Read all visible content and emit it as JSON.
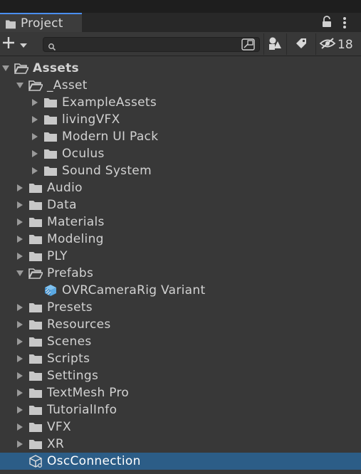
{
  "window": {
    "tab_label": "Project"
  },
  "toolbar": {
    "search_value": "",
    "hidden_count": "18"
  },
  "tree": {
    "assets": "Assets",
    "asset": "_Asset",
    "example_assets": "ExampleAssets",
    "living_vfx": "livingVFX",
    "modern_ui_pack": "Modern UI Pack",
    "oculus": "Oculus",
    "sound_system": "Sound System",
    "audio": "Audio",
    "data": "Data",
    "materials": "Materials",
    "modeling": "Modeling",
    "ply": "PLY",
    "prefabs": "Prefabs",
    "ovr_camera_rig": "OVRCameraRig Variant",
    "presets": "Presets",
    "resources": "Resources",
    "scenes": "Scenes",
    "scripts": "Scripts",
    "settings": "Settings",
    "textmesh_pro": "TextMesh Pro",
    "tutorial_info": "TutorialInfo",
    "vfx": "VFX",
    "xr": "XR",
    "osc_connection": "OscConnection"
  },
  "colors": {
    "selection": "#2c5d87",
    "tab_accent": "#4a8ef0",
    "text": "#d2d2d2",
    "prefab_blue": "#4fa3e0"
  }
}
